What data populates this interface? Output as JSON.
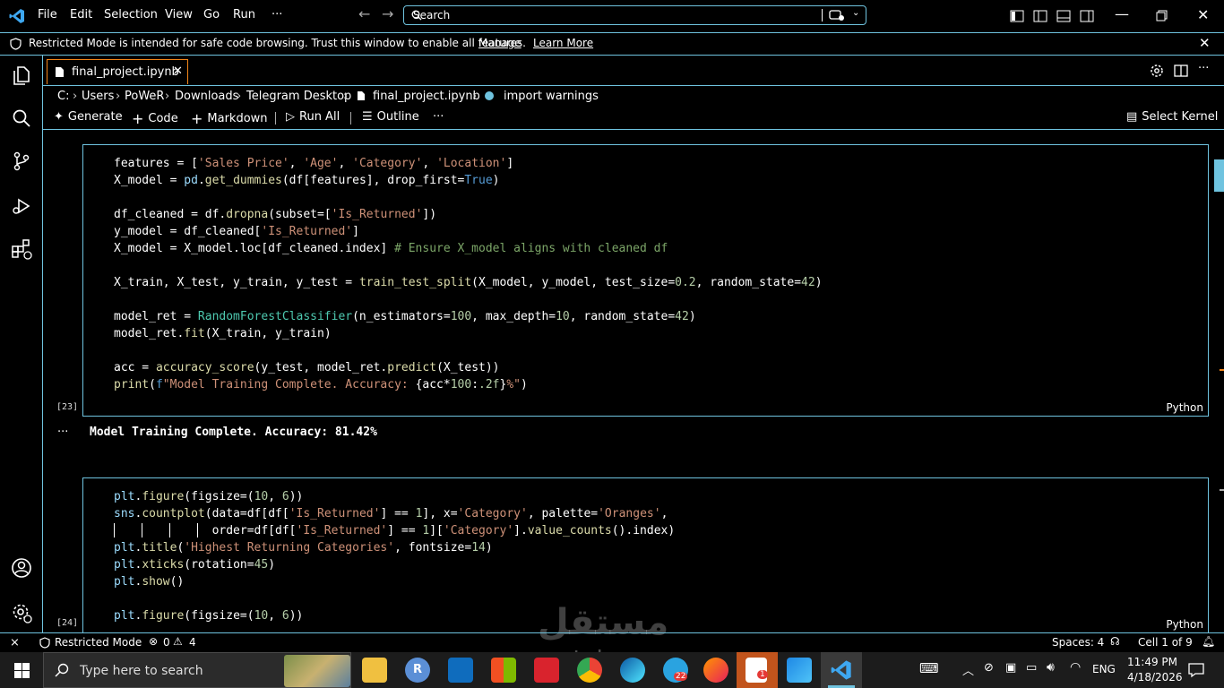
{
  "menu": {
    "file": "File",
    "edit": "Edit",
    "selection": "Selection",
    "view": "View",
    "go": "Go",
    "run": "Run",
    "more": "···"
  },
  "search": {
    "placeholder": "Search"
  },
  "banner": {
    "text": "Restricted Mode is intended for safe code browsing. Trust this window to enable all features.",
    "manage": "Manage",
    "learn_more": "Learn More"
  },
  "tab": {
    "label": "final_project.ipynb",
    "close": "✕"
  },
  "breadcrumb": {
    "c": "C:",
    "users": "Users",
    "power": "PoWeR",
    "downloads": "Downloads",
    "telegram": "Telegram Desktop",
    "file": "final_project.ipynb",
    "symbol": "import warnings",
    "sep": "›"
  },
  "toolbar": {
    "generate": "Generate",
    "code": "Code",
    "markdown": "Markdown",
    "run_all": "Run All",
    "outline": "Outline",
    "more": "···",
    "select_kernel": "Select Kernel"
  },
  "cell1": {
    "exec": "[23]",
    "lang": "Python"
  },
  "output1": {
    "ellipsis": "···",
    "text": "Model Training Complete. Accuracy: 81.42%"
  },
  "cell2": {
    "exec": "[24]",
    "lang": "Python"
  },
  "status": {
    "restricted": "Restricted Mode",
    "errors": "0",
    "warnings": "4",
    "spaces": "Spaces: 4",
    "cell": "Cell 1 of 9"
  },
  "taskbar": {
    "search": "Type here to search",
    "lang": "ENG",
    "time": "11:49 PM",
    "date": "4/18/2026",
    "telegram_badge": "22",
    "notif_badge": "1"
  },
  "watermark": {
    "text": "مستقل",
    "sub": "mostaql.com"
  },
  "colors": {
    "border": "#6fc3df",
    "accent": "#f38518",
    "vscode": "#3ea7f0"
  }
}
